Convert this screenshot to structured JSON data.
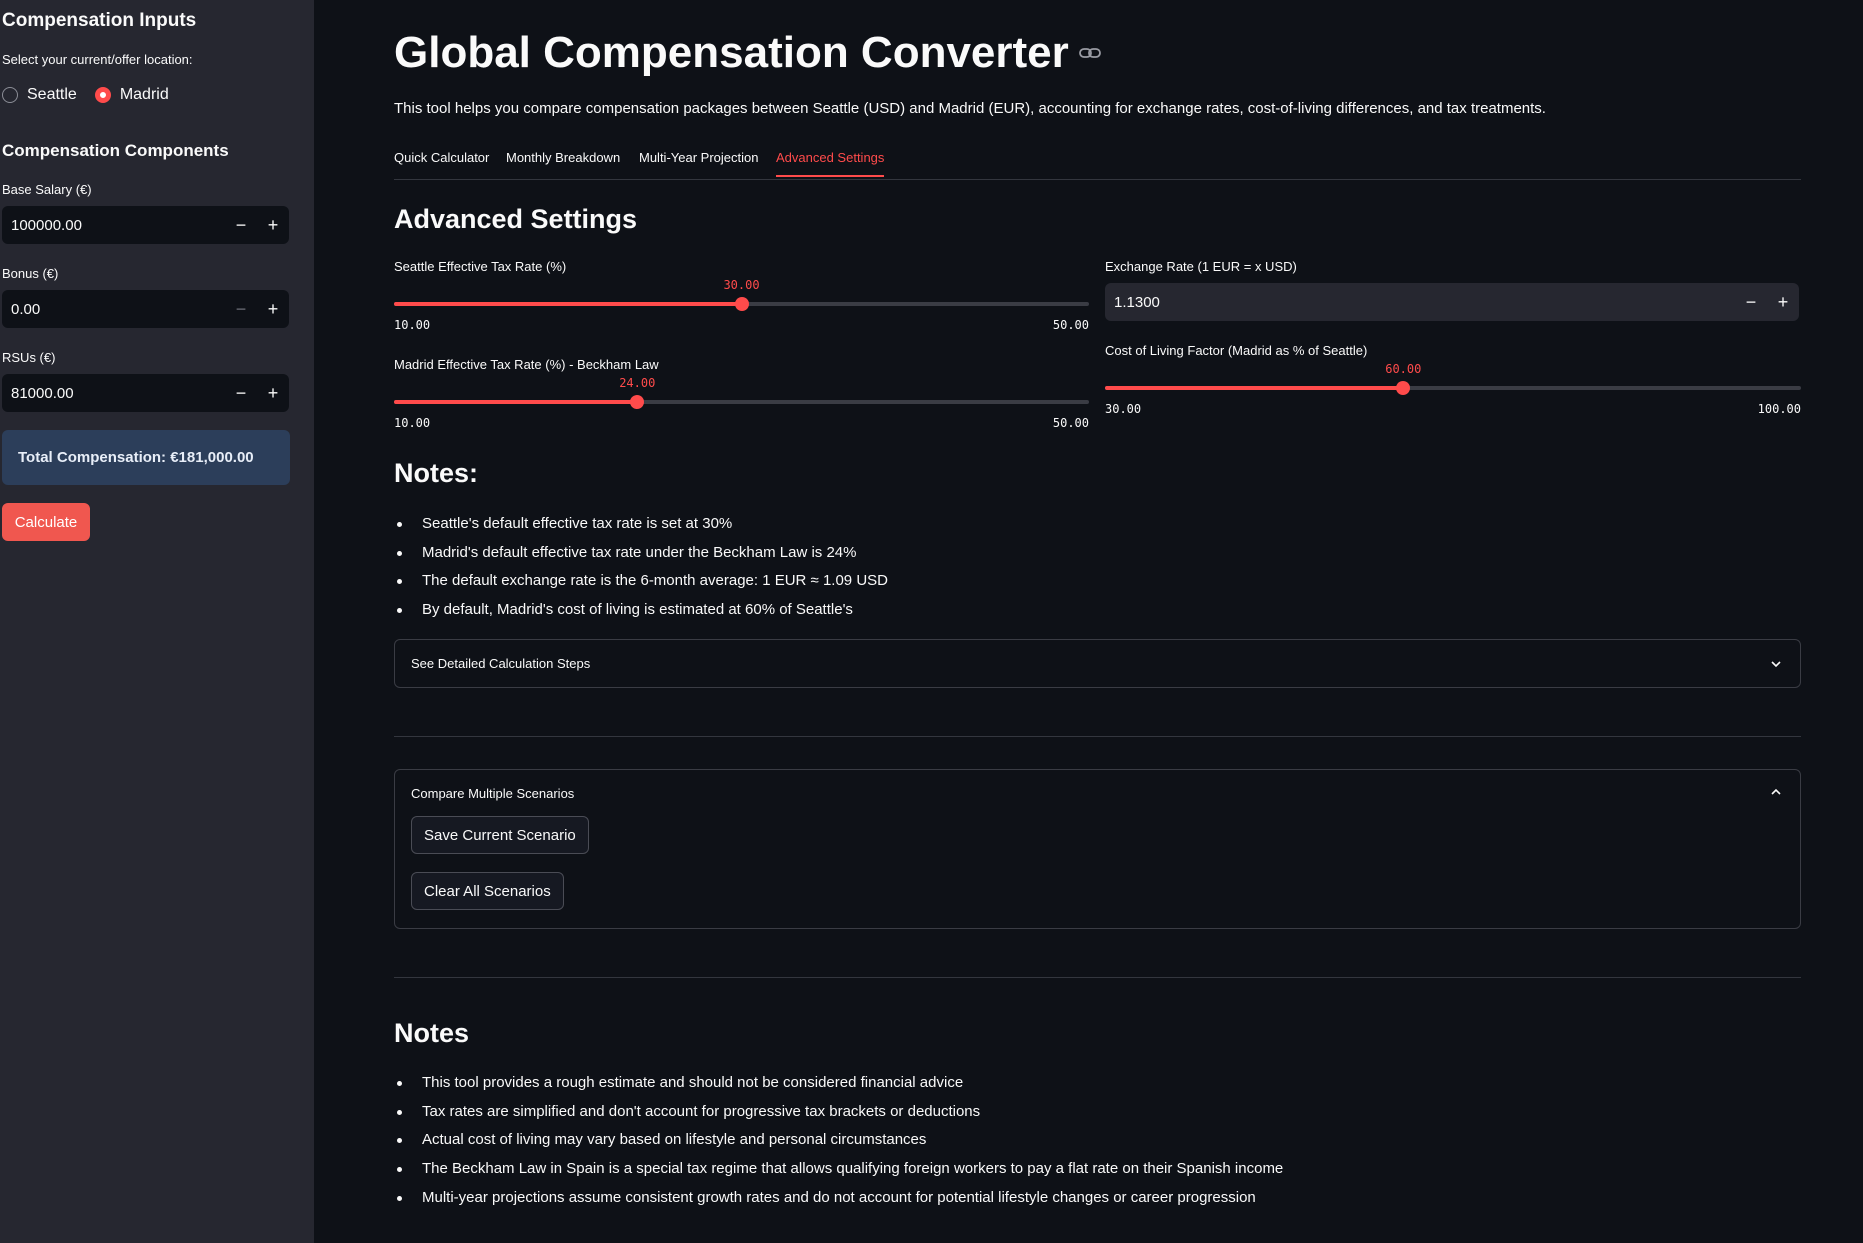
{
  "sidebar": {
    "heading": "Compensation Inputs",
    "location_prompt": "Select your current/offer location:",
    "locations": [
      {
        "label": "Seattle",
        "selected": false
      },
      {
        "label": "Madrid",
        "selected": true
      }
    ],
    "components_heading": "Compensation Components",
    "base_salary": {
      "label": "Base Salary (€)",
      "value": "100000.00"
    },
    "bonus": {
      "label": "Bonus (€)",
      "value": "0.00"
    },
    "rsus": {
      "label": "RSUs (€)",
      "value": "81000.00"
    },
    "stepper": {
      "minus": "−",
      "plus": "+"
    },
    "total": "Total Compensation: €181,000.00",
    "calculate_label": "Calculate"
  },
  "main": {
    "title": "Global Compensation Converter",
    "intro": "This tool helps you compare compensation packages between Seattle (USD) and Madrid (EUR), accounting for exchange rates, cost-of-living differences, and tax treatments.",
    "tabs": [
      {
        "label": "Quick Calculator",
        "active": false
      },
      {
        "label": "Monthly Breakdown",
        "active": false
      },
      {
        "label": "Multi-Year Projection",
        "active": false
      },
      {
        "label": "Advanced Settings",
        "active": true
      }
    ],
    "advanced_heading": "Advanced Settings",
    "seattle_tax": {
      "label": "Seattle Effective Tax Rate (%)",
      "value": 30.0,
      "value_text": "30.00",
      "min": 10,
      "max": 50,
      "min_text": "10.00",
      "max_text": "50.00"
    },
    "madrid_tax": {
      "label": "Madrid Effective Tax Rate (%) - Beckham Law",
      "value": 24.0,
      "value_text": "24.00",
      "min": 10,
      "max": 50,
      "min_text": "10.00",
      "max_text": "50.00"
    },
    "exchange_rate": {
      "label": "Exchange Rate (1 EUR = x USD)",
      "value": "1.1300"
    },
    "col_factor": {
      "label": "Cost of Living Factor (Madrid as % of Seattle)",
      "value": 60.0,
      "value_text": "60.00",
      "min": 30,
      "max": 100,
      "min_text": "30.00",
      "max_text": "100.00"
    },
    "notes_heading": "Notes:",
    "notes": [
      "Seattle's default effective tax rate is set at 30%",
      "Madrid's default effective tax rate under the Beckham Law is 24%",
      "The default exchange rate is the 6-month average: 1 EUR ≈ 1.09 USD",
      "By default, Madrid's cost of living is estimated at 60% of Seattle's"
    ],
    "detail_expander": "See Detailed Calculation Steps",
    "compare_expander": "Compare Multiple Scenarios",
    "save_scenario": "Save Current Scenario",
    "clear_scenarios": "Clear All Scenarios",
    "notes2_heading": "Notes",
    "notes2": [
      "This tool provides a rough estimate and should not be considered financial advice",
      "Tax rates are simplified and don't account for progressive tax brackets or deductions",
      "Actual cost of living may vary based on lifestyle and personal circumstances",
      "The Beckham Law in Spain is a special tax regime that allows qualifying foreign workers to pay a flat rate on their Spanish income",
      "Multi-year projections assume consistent growth rates and do not account for potential lifestyle changes or career progression"
    ]
  },
  "colors": {
    "accent": "#ff4b4b",
    "background": "#0e1117",
    "sidebar": "#262730",
    "total_box": "#2c3e5a"
  },
  "icons": [
    "link-icon",
    "chevron-down-icon",
    "chevron-up-icon"
  ]
}
